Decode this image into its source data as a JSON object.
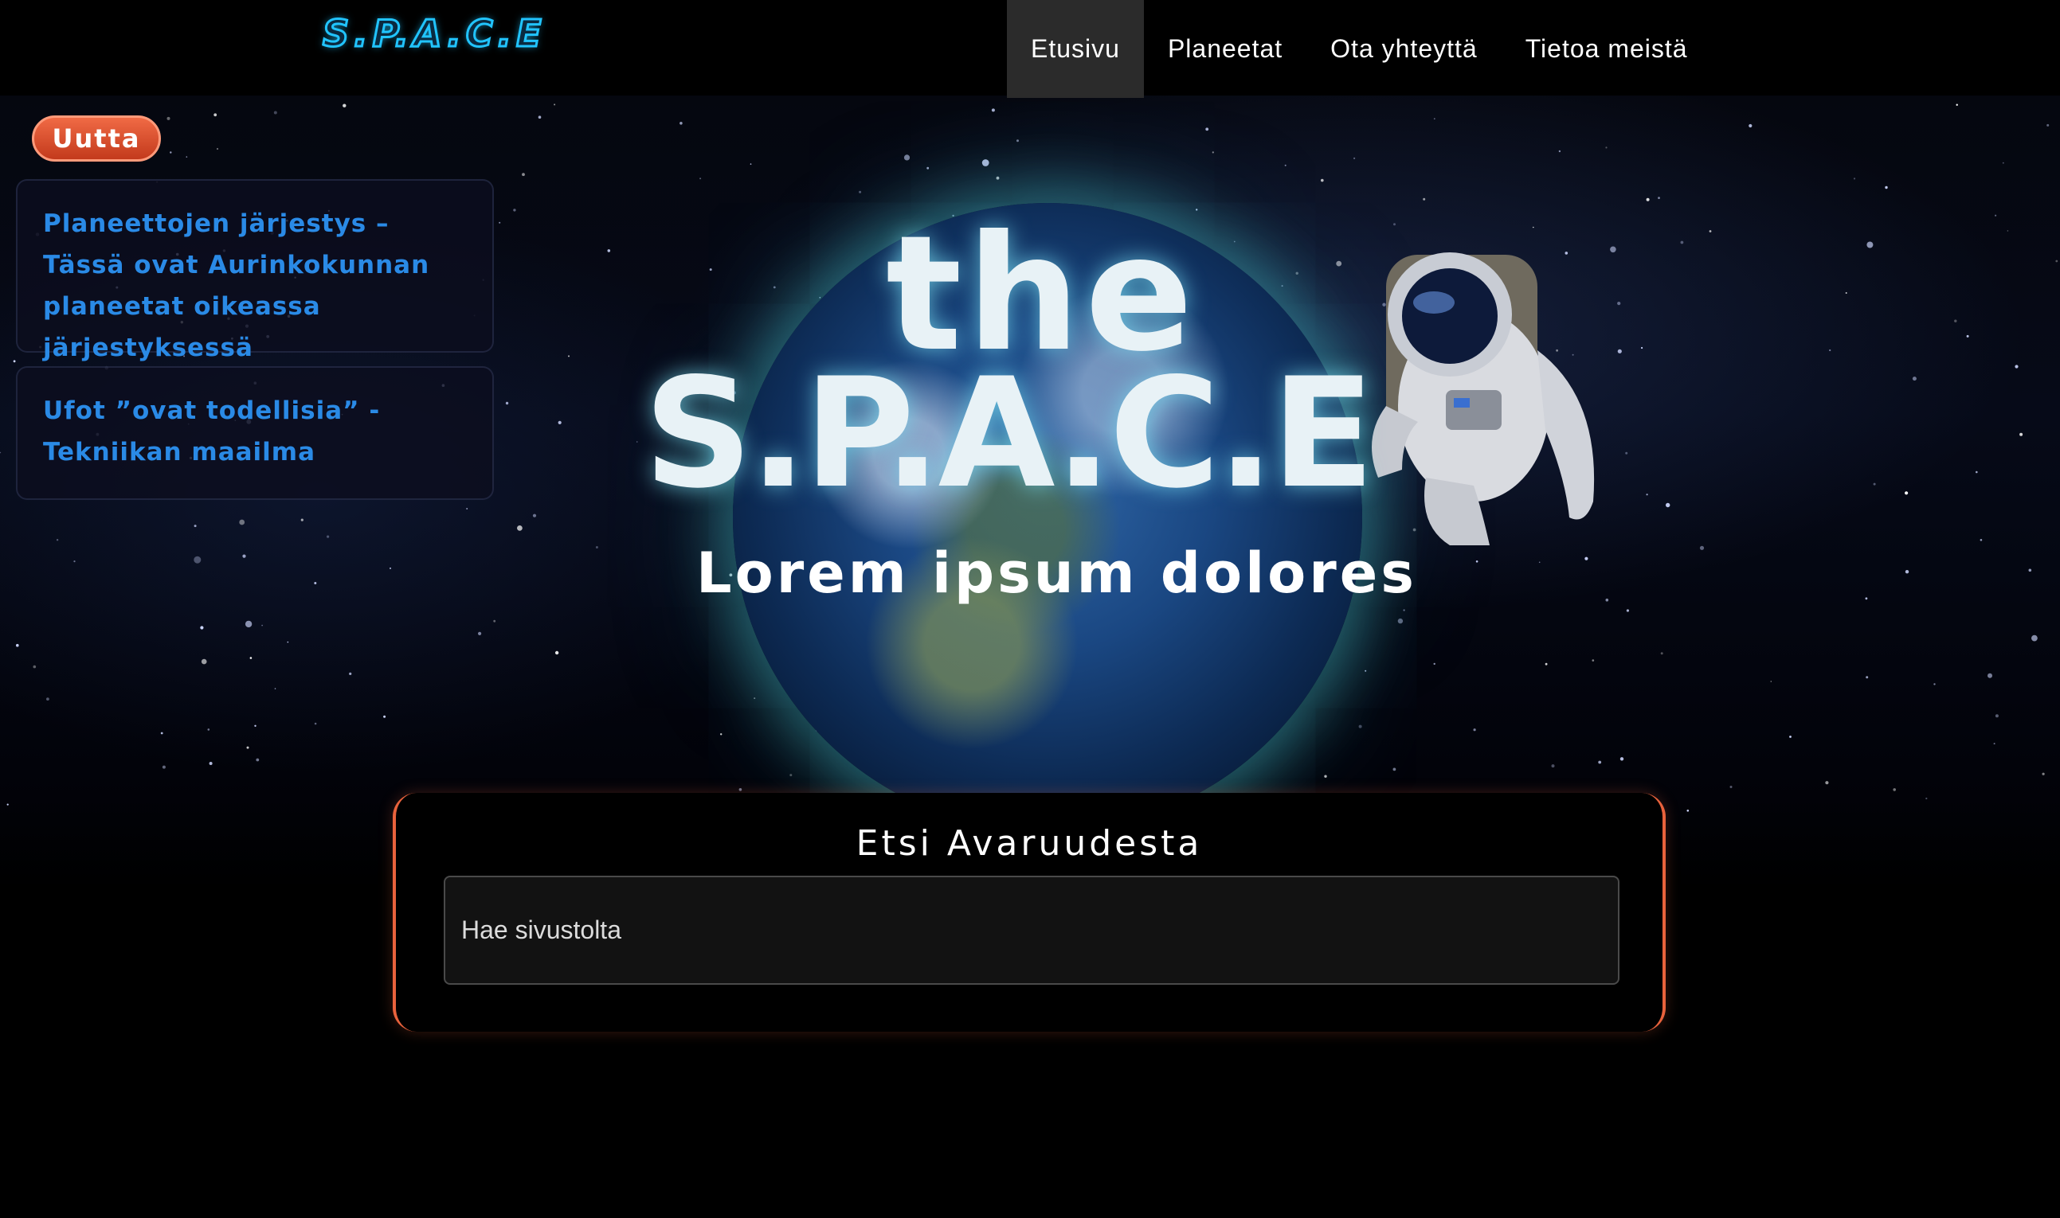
{
  "header": {
    "logo_text": "S.P.A.C.E",
    "nav": [
      {
        "label": "Etusivu",
        "active": true
      },
      {
        "label": "Planeetat",
        "active": false
      },
      {
        "label": "Ota yhteyttä",
        "active": false
      },
      {
        "label": "Tietoa meistä",
        "active": false
      }
    ]
  },
  "news": {
    "badge": "Uutta",
    "items": [
      {
        "title": "Planeettojen järjestys – Tässä ovat Aurinkokunnan planeetat oikeassa järjestyksessä"
      },
      {
        "title": "Ufot ”ovat todellisia” - Tekniikan maailma"
      }
    ]
  },
  "hero": {
    "line1": "the",
    "line2": "S.P.A.C.E",
    "subtitle": "Lorem ipsum dolores"
  },
  "search": {
    "title": "Etsi Avaruudesta",
    "placeholder": "Hae sivustolta",
    "value": ""
  },
  "colors": {
    "accent_orange": "#e8623c",
    "link_blue": "#2a8ae6",
    "logo_cyan": "#21c4ff",
    "nav_active_bg": "#2b2b2b"
  },
  "icons": {
    "hero_image": "earth-with-astronaut"
  }
}
